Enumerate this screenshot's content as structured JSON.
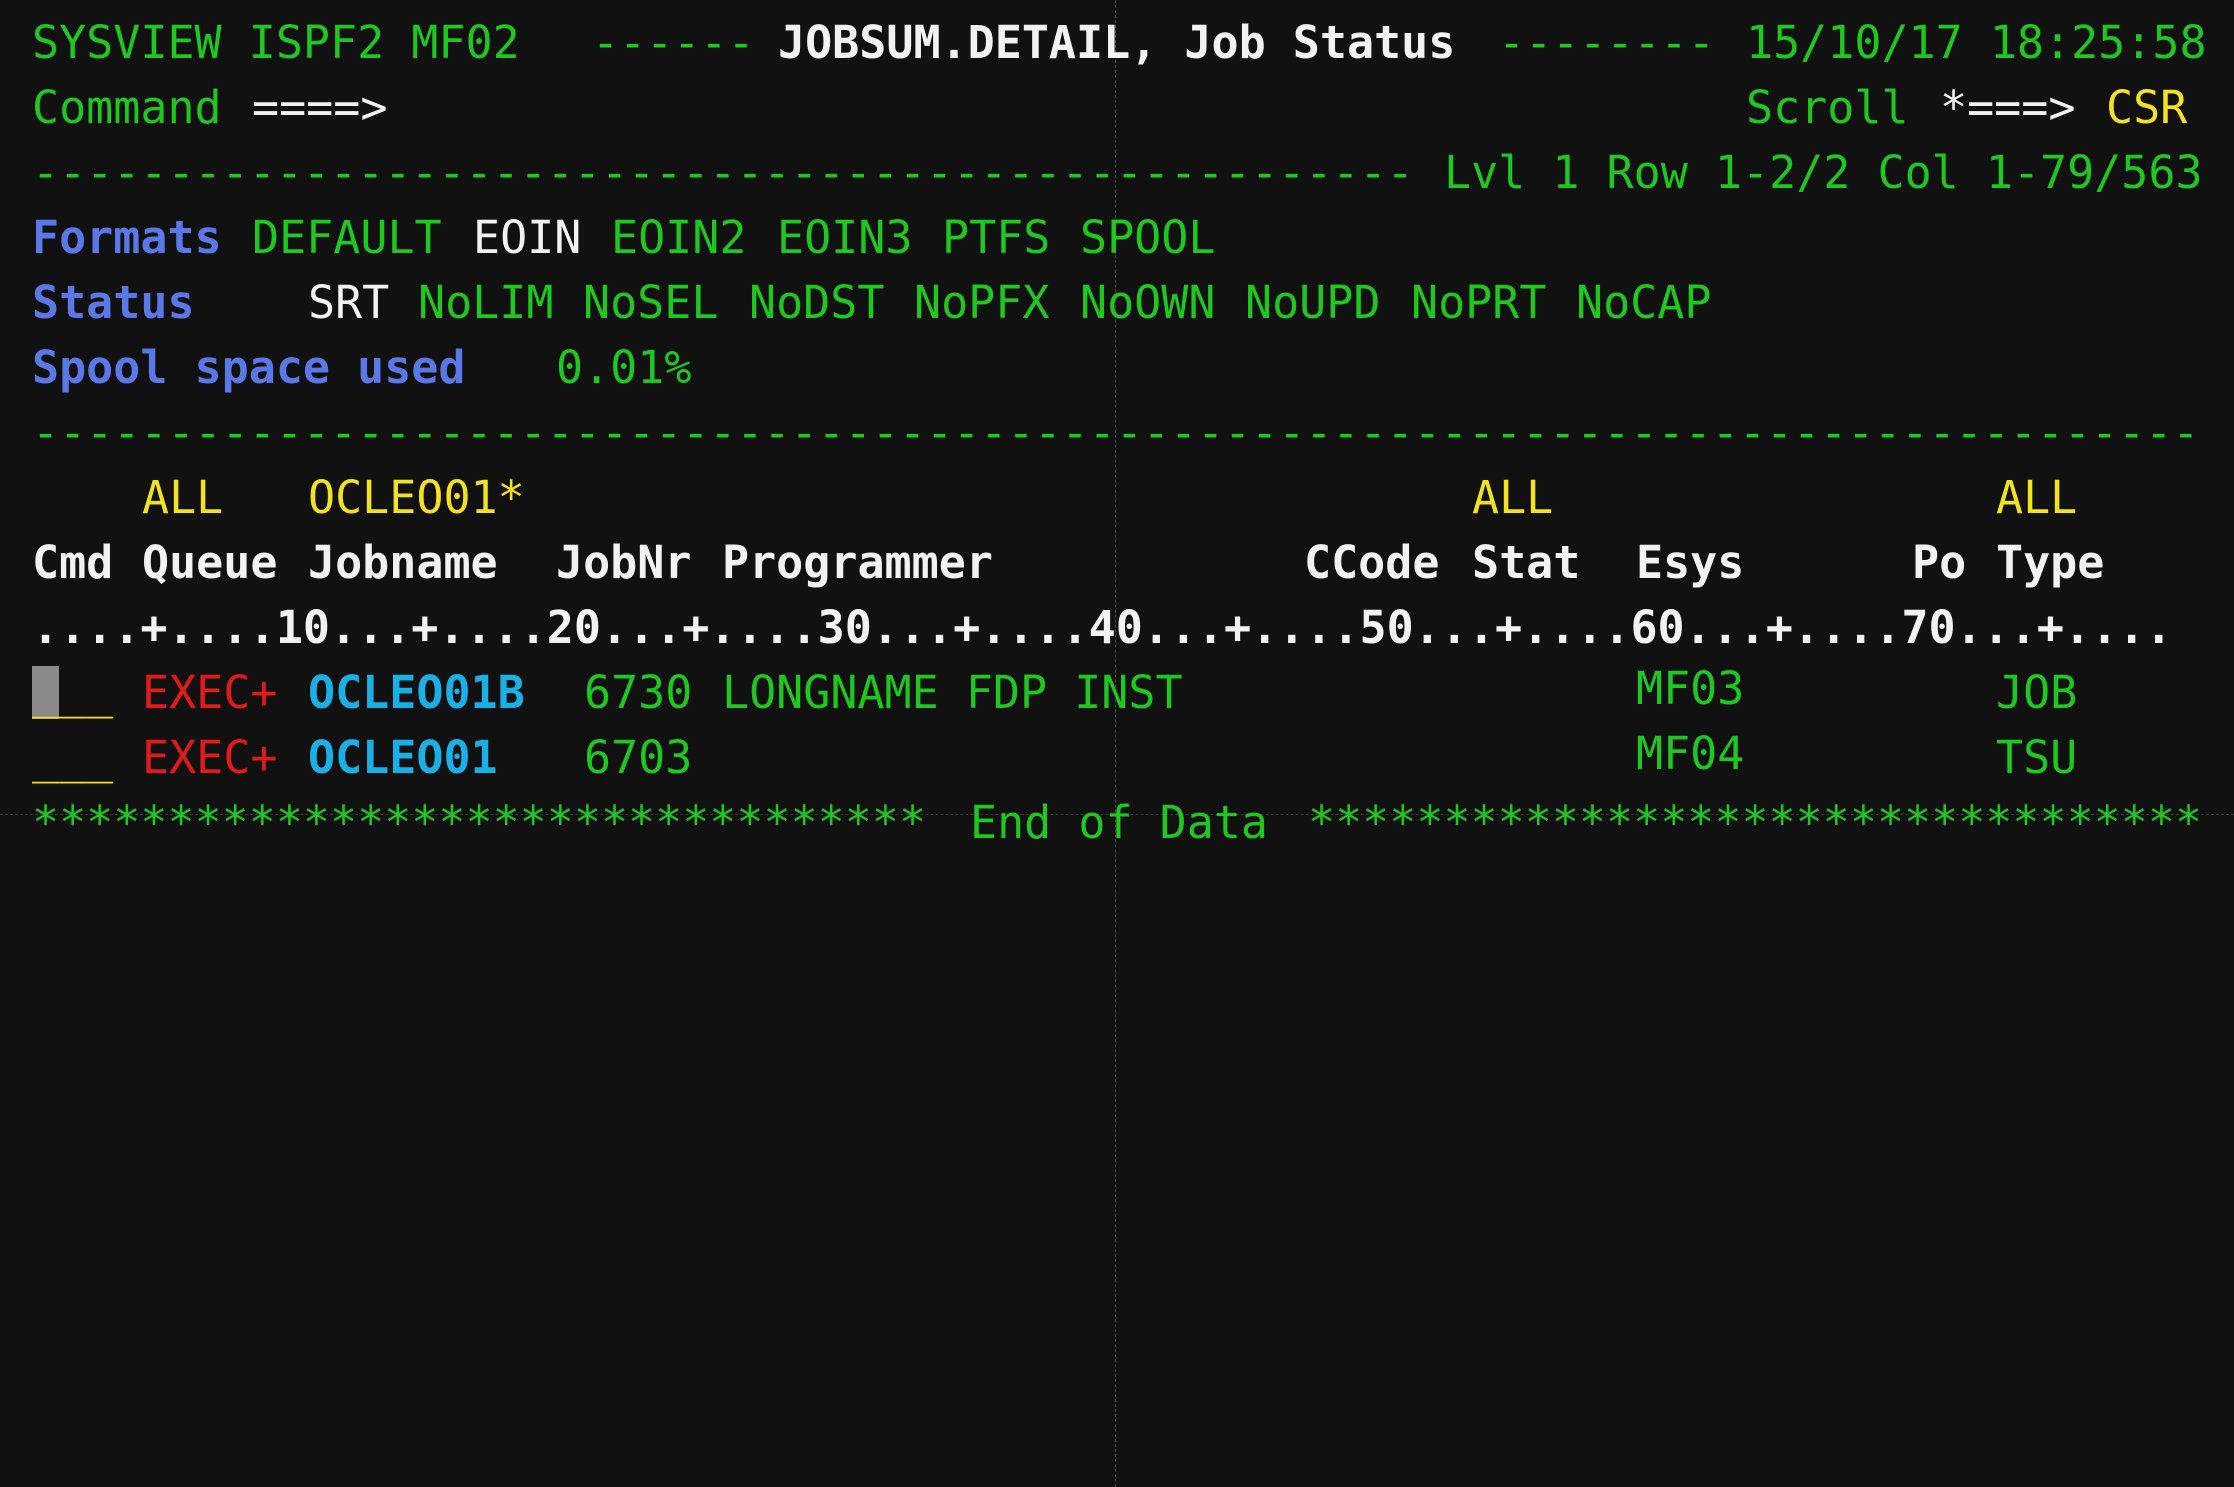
{
  "header": {
    "left": "SYSVIEW ISPF2 MF02",
    "dashes_left": "------",
    "title": "JOBSUM.DETAIL, Job Status",
    "dashes_right": "--------",
    "datetime": "15/10/17 18:25:58"
  },
  "command": {
    "label": "Command",
    "arrow": "====>",
    "value": "",
    "scroll_label": "Scroll",
    "scroll_arrow": "*===>",
    "scroll_value": "CSR"
  },
  "info_line": {
    "dashes": "---------------------------------------------------",
    "text": "Lvl 1 Row 1-2/2 Col 1-79/563"
  },
  "formats": {
    "label": "Formats",
    "items": [
      "DEFAULT",
      "EOIN",
      "EOIN2",
      "EOIN3",
      "PTFS",
      "SPOOL"
    ],
    "active_index": 1
  },
  "status": {
    "label": "Status",
    "items": [
      "SRT",
      "NoLIM",
      "NoSEL",
      "NoDST",
      "NoPFX",
      "NoOWN",
      "NoUPD",
      "NoPRT",
      "NoCAP"
    ]
  },
  "spool": {
    "label": "Spool space used",
    "value": "0.01%"
  },
  "separator": "--------------------------------------------------------------------------------",
  "filters": {
    "queue": "ALL",
    "jobname": "OCLEO01*",
    "stat": "ALL",
    "type": "ALL"
  },
  "columns": {
    "cmd": "Cmd",
    "queue": "Queue",
    "jobname": "Jobname",
    "jobnr": "JobNr",
    "programmer": "Programmer",
    "ccode": "CCode",
    "stat": "Stat",
    "esys": "Esys",
    "po": "Po",
    "type": "Type"
  },
  "ruler": "....+....10...+....20...+....30...+....40...+....50...+....60...+....70...+....",
  "rows": [
    {
      "cmd": "___",
      "queue": "EXEC+",
      "jobname": "OCLEO01B",
      "jobnr": "6730",
      "programmer": "LONGNAME FDP INST",
      "esys": "MF03",
      "type": "JOB"
    },
    {
      "cmd": "___",
      "queue": "EXEC+",
      "jobname": "OCLEO01",
      "jobnr": "6703",
      "programmer": "",
      "esys": "MF04",
      "type": "TSU"
    }
  ],
  "end_of_data": {
    "stars_left": "*********************************",
    "text": "End of Data",
    "stars_right": "*********************************"
  },
  "colors": {
    "background": "#111111",
    "green": "#1fc81f",
    "white": "#f2f2f2",
    "yellow": "#f3e21e",
    "blue": "#5a78e8",
    "red": "#e41a1a",
    "turquoise": "#19b0e6"
  }
}
